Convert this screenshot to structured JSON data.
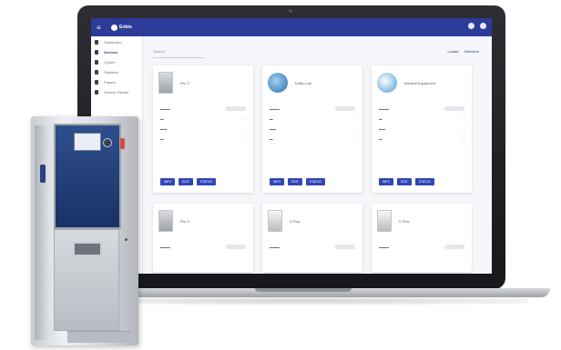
{
  "app": {
    "brand": "Enbio",
    "colors": {
      "accent": "#2c3b97",
      "button": "#3047b5"
    }
  },
  "sidebar": {
    "items": [
      {
        "label": "Dashboard",
        "icon": "dashboard-icon"
      },
      {
        "label": "Devices",
        "icon": "devices-icon"
      },
      {
        "label": "Cycles",
        "icon": "cycles-icon"
      },
      {
        "label": "Statistics",
        "icon": "statistics-icon"
      },
      {
        "label": "Papers",
        "icon": "papers-icon"
      },
      {
        "label": "Service Partner",
        "icon": "service-icon"
      }
    ]
  },
  "toolbar": {
    "search_placeholder": "Search",
    "action_1": "Locate",
    "action_2": "Selection"
  },
  "cards": [
    {
      "name": "Pro 3"
    },
    {
      "name": "EnBio Lab"
    },
    {
      "name": "Medical Equipment"
    },
    {
      "name": "Pro 3"
    },
    {
      "name": "S Plus"
    },
    {
      "name": "S Plus"
    }
  ],
  "card_buttons": {
    "info": "INFO",
    "edit": "EDIT",
    "status": "STATUS"
  }
}
